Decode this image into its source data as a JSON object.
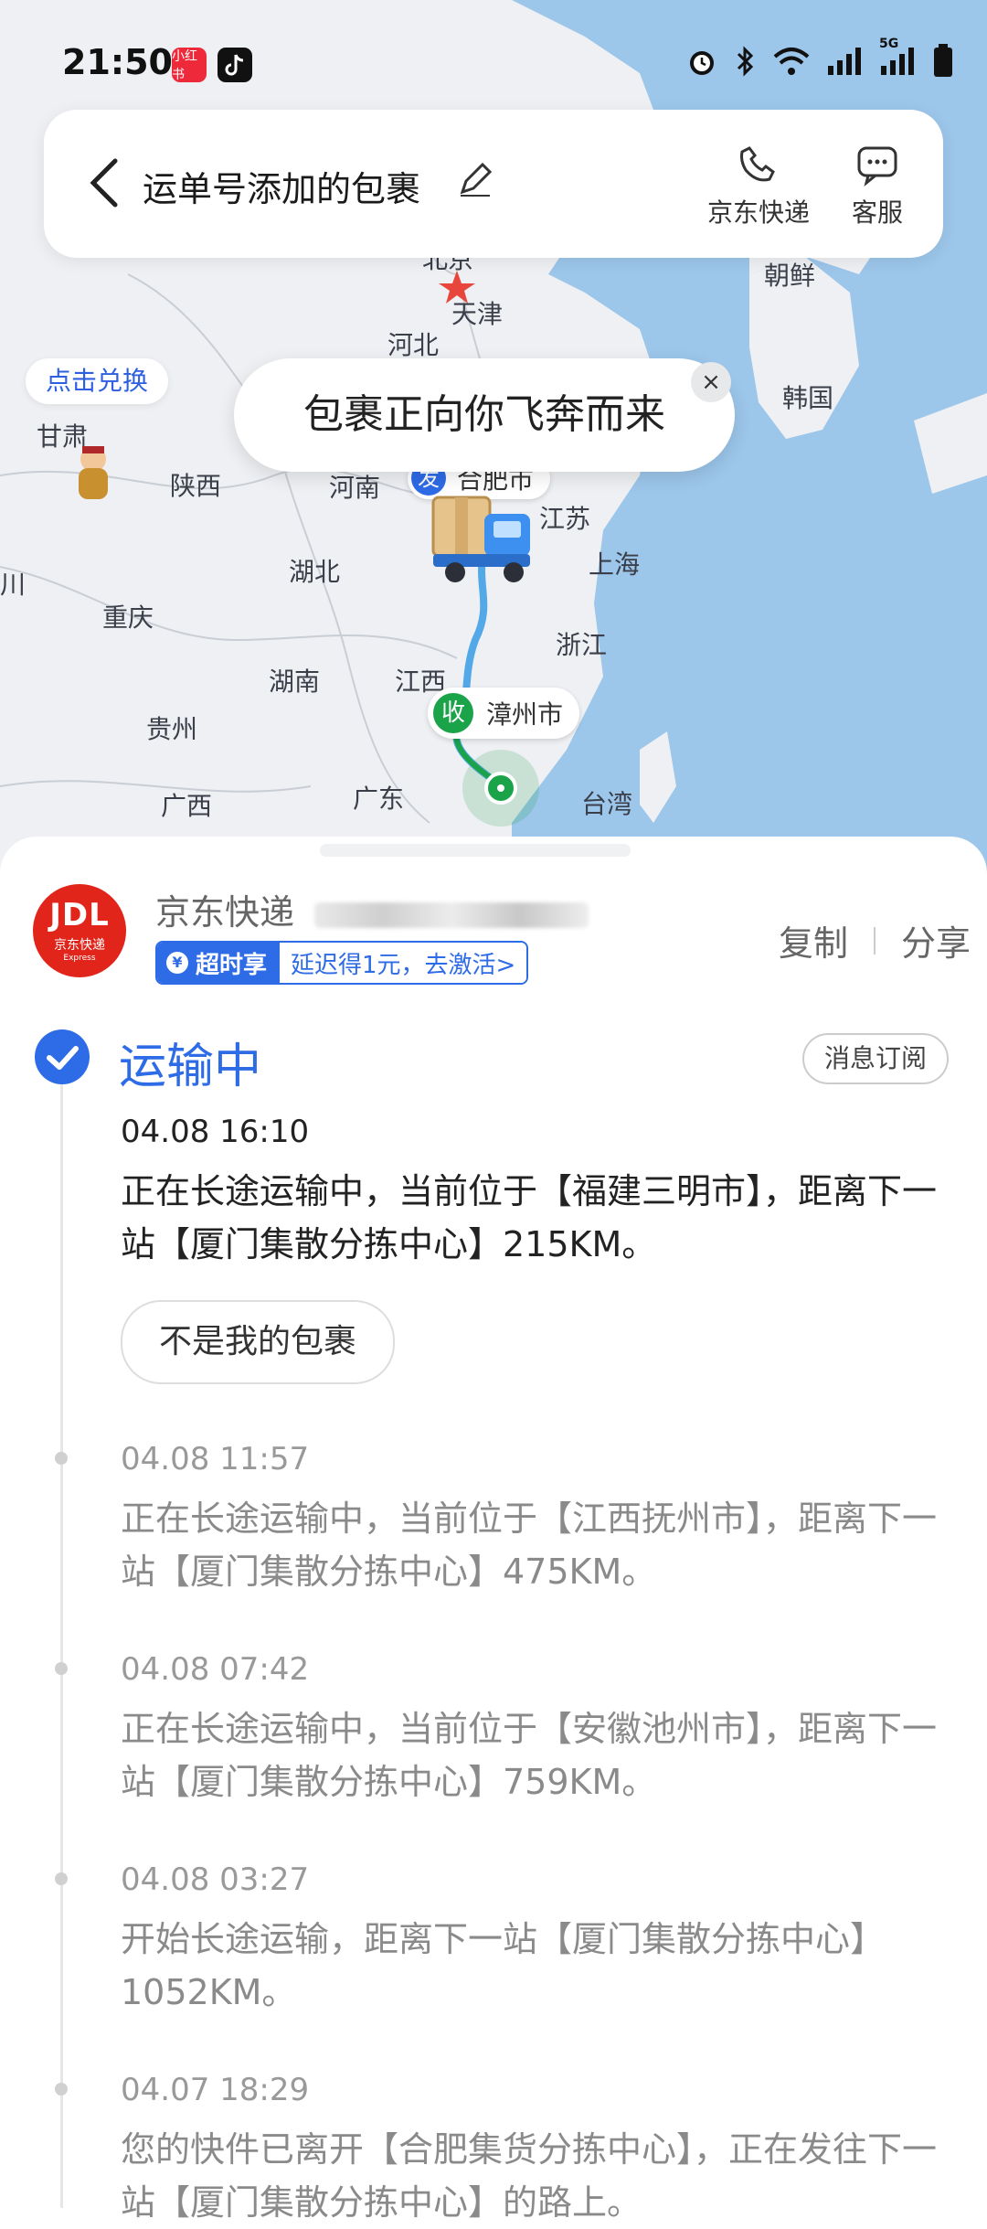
{
  "status_bar": {
    "time": "21:50",
    "app1": "小红书",
    "network": "5G"
  },
  "header": {
    "title": "运单号添加的包裹",
    "btn_courier": "京东快递",
    "btn_service": "客服"
  },
  "map": {
    "hint": "点击兑换",
    "bubble": "包裹正向你飞奔而来",
    "close": "×",
    "from_marker": "发",
    "from_city": "合肥市",
    "to_marker": "收",
    "to_city": "漳州市",
    "labels": [
      "北京",
      "天津",
      "河北",
      "朝鲜",
      "韩国",
      "甘肃",
      "陕西",
      "河南",
      "江苏",
      "上海",
      "湖北",
      "重庆",
      "湖南",
      "江西",
      "浙江",
      "贵州",
      "广西",
      "广东",
      "台湾",
      "川"
    ]
  },
  "package": {
    "logo_text": "JDL",
    "logo_sub": "京东快递",
    "logo_express": "Express",
    "carrier": "京东快递",
    "promo_tag": "超时享",
    "promo_text": "延迟得1元，去激活>",
    "copy": "复制",
    "share": "分享"
  },
  "tracking": {
    "status": "运输中",
    "subscribe": "消息订阅",
    "not_mine": "不是我的包裹",
    "events": [
      {
        "time": "04.08 16:10",
        "text": "正在长途运输中，当前位于【福建三明市】，距离下一站【厦门集散分拣中心】215KM。"
      },
      {
        "time": "04.08 11:57",
        "text": "正在长途运输中，当前位于【江西抚州市】，距离下一站【厦门集散分拣中心】475KM。"
      },
      {
        "time": "04.08 07:42",
        "text": "正在长途运输中，当前位于【安徽池州市】，距离下一站【厦门集散分拣中心】759KM。"
      },
      {
        "time": "04.08 03:27",
        "text": "开始长途运输，距离下一站【厦门集散分拣中心】1052KM。"
      },
      {
        "time": "04.07 18:29",
        "text": "您的快件已离开【合肥集货分拣中心】，正在发往下一站【厦门集散分拣中心】的路上。"
      }
    ]
  },
  "colors": {
    "accent": "#2e6be6",
    "jd_red": "#e1251b",
    "sea": "#9cc6ea",
    "land": "#eef0f3",
    "route": "#1ba34a"
  }
}
